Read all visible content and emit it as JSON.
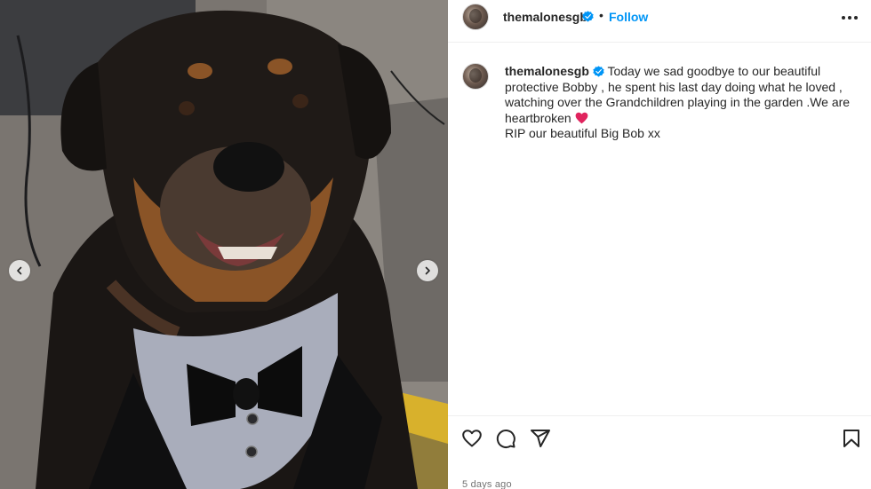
{
  "post": {
    "media": {
      "image_description_icon": "dog-photo",
      "prev_button_icon": "chevron-left-icon",
      "next_button_icon": "chevron-right-icon"
    },
    "header": {
      "username": "themalonesgb",
      "separator": "•",
      "follow_label": "Follow",
      "more_icon": "more-options-icon"
    },
    "caption": {
      "username": "themalonesgb",
      "text": "Today we sad goodbye to our beautiful protective Bobby , he spent his last day doing what he loved , watching over the Grandchildren playing in the garden .We are heartbroken",
      "emoji": "red-heart",
      "text_after": "RIP our beautiful Big Bob xx"
    },
    "actions": {
      "like_icon": "heart-icon",
      "comment_icon": "comment-icon",
      "share_icon": "share-icon",
      "save_icon": "bookmark-icon"
    },
    "timestamp": "5 days ago"
  },
  "colors": {
    "link": "#0095f6",
    "verified": "#0095f6",
    "text": "#262626",
    "muted": "#737373",
    "heart_emoji": "#e0245e"
  }
}
